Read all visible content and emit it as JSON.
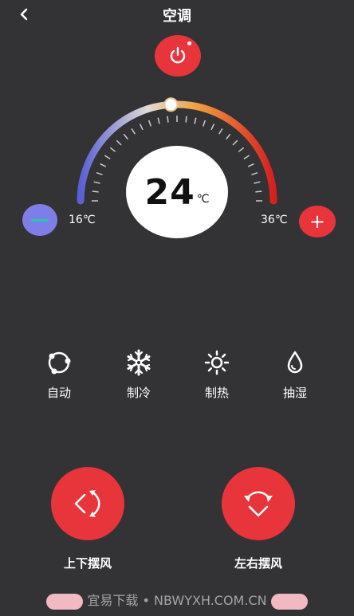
{
  "header": {
    "title": "空调"
  },
  "temperature": {
    "value": "24",
    "unit": "℃",
    "current": 24,
    "min": 16,
    "max": 36
  },
  "range": {
    "min_label": "16℃",
    "max_label": "36℃"
  },
  "modes": [
    {
      "label": "自动",
      "icon": "auto-cycle-icon"
    },
    {
      "label": "制冷",
      "icon": "snowflake-icon"
    },
    {
      "label": "制热",
      "icon": "sun-icon"
    },
    {
      "label": "抽湿",
      "icon": "water-drop-icon"
    }
  ],
  "swing": {
    "vertical_label": "上下摆风",
    "horizontal_label": "左右摆风"
  },
  "watermark": {
    "text": "宜易下载 • NBWYXH.COM.CN"
  },
  "colors": {
    "background": "#333335",
    "accent_red": "#e8343b",
    "minus_purple": "#7f7ee8",
    "arc_cool": "#5a5fd6",
    "arc_warm": "#f0a040",
    "arc_hot": "#d62020"
  }
}
